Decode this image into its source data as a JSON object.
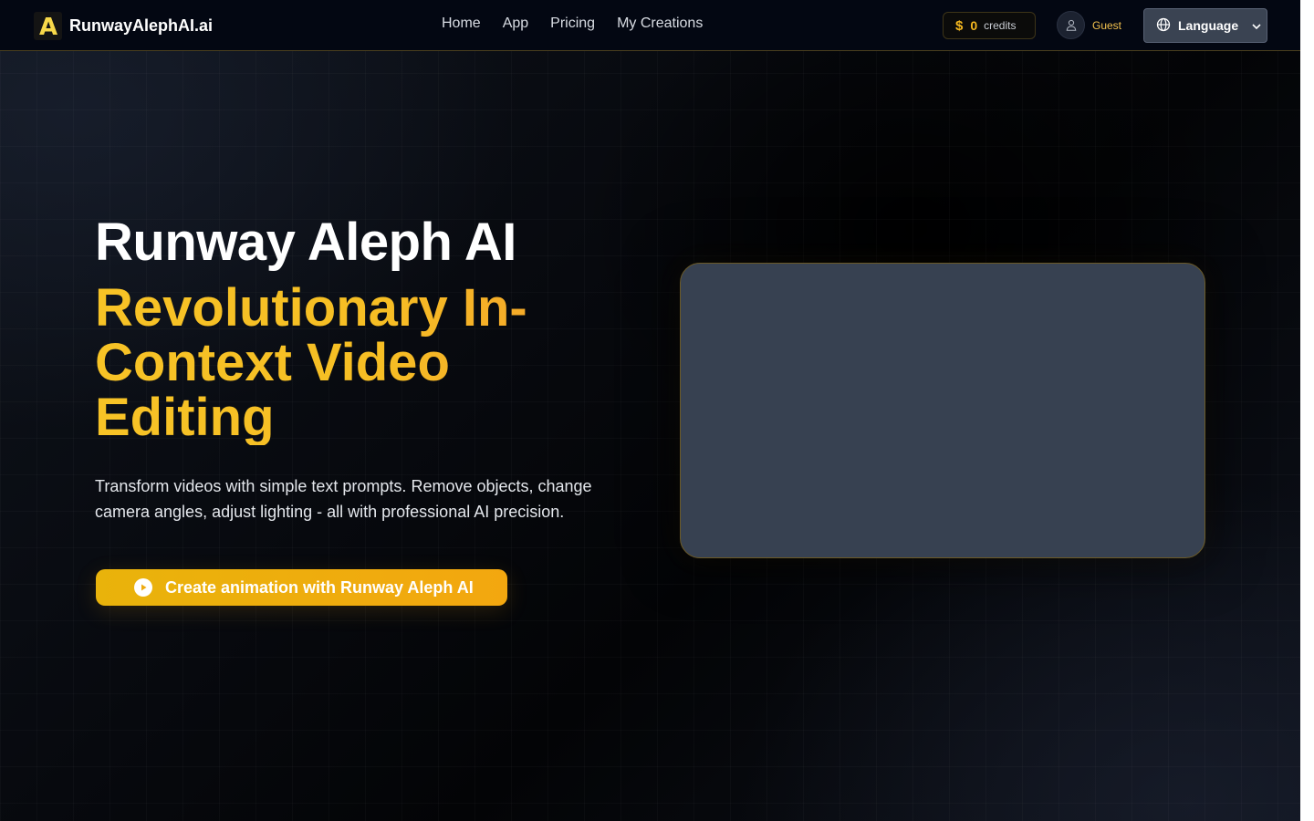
{
  "header": {
    "logo_letter": "A",
    "brand": "RunwayAlephAI.ai",
    "nav": [
      "Home",
      "App",
      "Pricing",
      "My Creations"
    ],
    "credits": {
      "symbol": "$",
      "count": "0",
      "label": "credits"
    },
    "user": {
      "name": "Guest"
    },
    "language_label": "Language"
  },
  "hero": {
    "title": "Runway Aleph AI",
    "subtitle_lines": [
      "Revolutionary In-",
      "Context Video",
      "Editing"
    ],
    "description_lines": [
      "Transform videos with simple text prompts. Remove objects, change",
      "camera angles, adjust lighting - all with professional AI precision."
    ],
    "cta_label": "Create animation with Runway Aleph AI"
  },
  "colors": {
    "accent": "#f5b81f",
    "header_bg": "#030712",
    "video_placeholder": "#374151"
  },
  "icons": {
    "credits": "dollar-icon",
    "user": "user-icon",
    "language": "globe-icon",
    "language_toggle": "chevron-down-icon",
    "cta": "play-icon"
  }
}
